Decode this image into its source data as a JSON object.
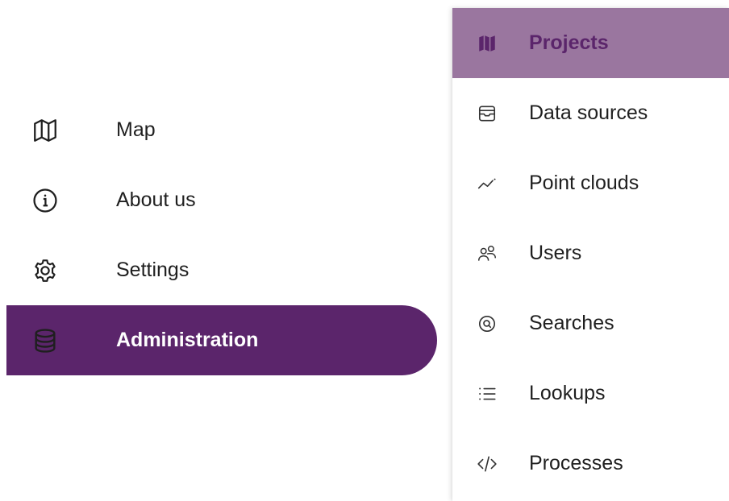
{
  "left_nav": {
    "items": [
      {
        "label": "Map",
        "icon": "map-icon",
        "active": false
      },
      {
        "label": "About us",
        "icon": "info-icon",
        "active": false
      },
      {
        "label": "Settings",
        "icon": "gear-icon",
        "active": false
      },
      {
        "label": "Administration",
        "icon": "database-icon",
        "active": true
      }
    ]
  },
  "submenu": {
    "items": [
      {
        "label": "Projects",
        "icon": "map-filled-icon",
        "active": true
      },
      {
        "label": "Data sources",
        "icon": "inbox-icon",
        "active": false
      },
      {
        "label": "Point clouds",
        "icon": "trend-line-icon",
        "active": false
      },
      {
        "label": "Users",
        "icon": "users-icon",
        "active": false
      },
      {
        "label": "Searches",
        "icon": "search-circle-icon",
        "active": false
      },
      {
        "label": "Lookups",
        "icon": "list-icon",
        "active": false
      },
      {
        "label": "Processes",
        "icon": "code-icon",
        "active": false
      }
    ]
  },
  "colors": {
    "accent": "#5b256b",
    "submenu_active_bg": "#9a769f",
    "text": "#1f1f1f"
  }
}
